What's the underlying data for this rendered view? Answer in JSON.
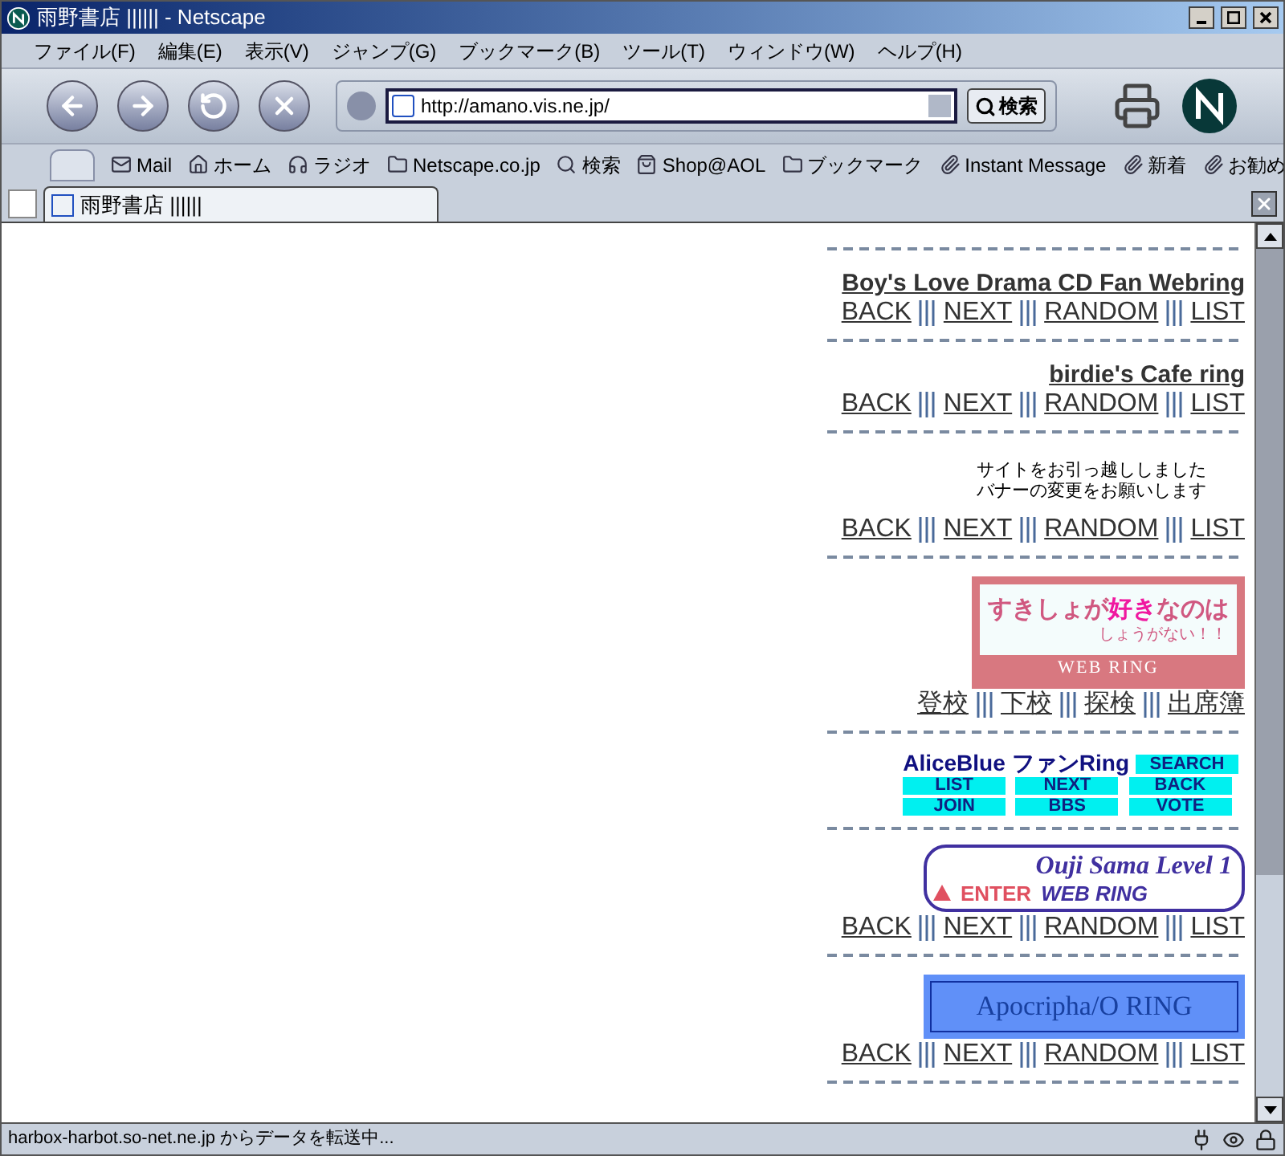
{
  "window": {
    "title": "雨野書店 ||||||  - Netscape"
  },
  "menu": [
    "ファイル(F)",
    "編集(E)",
    "表示(V)",
    "ジャンプ(G)",
    "ブックマーク(B)",
    "ツール(T)",
    "ウィンドウ(W)",
    "ヘルプ(H)"
  ],
  "address": {
    "value": "http://amano.vis.ne.jp/",
    "search_button": "検索"
  },
  "personal_bar": [
    {
      "kind": "mail",
      "label": "Mail"
    },
    {
      "kind": "home",
      "label": "ホーム"
    },
    {
      "kind": "radio",
      "label": "ラジオ"
    },
    {
      "kind": "my",
      "label": "Netscape.co.jp"
    },
    {
      "kind": "search",
      "label": "検索"
    },
    {
      "kind": "shop",
      "label": "Shop@AOL"
    },
    {
      "kind": "folder",
      "label": "ブックマーク"
    },
    {
      "kind": "link",
      "label": "Instant Message"
    },
    {
      "kind": "link",
      "label": "新着"
    },
    {
      "kind": "link",
      "label": "お勧め"
    }
  ],
  "tabs": [
    {
      "label": "雨野書店 ||||||",
      "selected": true
    }
  ],
  "blocks": [
    {
      "kind": "title",
      "title": "Boy's Love Drama CD Fan Webring",
      "links": [
        "BACK",
        "NEXT",
        "RANDOM",
        "LIST"
      ]
    },
    {
      "kind": "title",
      "title": "birdie's Cafe ring",
      "links": [
        "BACK",
        "NEXT",
        "RANDOM",
        "LIST"
      ]
    },
    {
      "kind": "notice",
      "lines": [
        "サイトをお引っ越ししました",
        "バナーの変更をお願いします"
      ],
      "links": [
        "BACK",
        "NEXT",
        "RANDOM",
        "LIST"
      ]
    },
    {
      "kind": "sukisho",
      "segments": [
        {
          "text": "すきしょが",
          "accent": false
        },
        {
          "text": "好き",
          "accent": true
        },
        {
          "text": "なのは",
          "accent": false
        }
      ],
      "sub": "しょうがない！！",
      "ring": "WEB RING",
      "links": [
        "登校",
        "下校",
        "探検",
        "出席簿"
      ]
    },
    {
      "kind": "grid",
      "heading": [
        "AliceBlue",
        "ファンRing"
      ],
      "buttons": [
        "SEARCH",
        "LIST",
        "NEXT",
        "BACK",
        "JOIN",
        "BBS",
        "VOTE"
      ]
    },
    {
      "kind": "ouji",
      "heading": "Ouji Sama  Level 1",
      "enter": "ENTER",
      "ring": "WEB RING",
      "links": [
        "BACK",
        "NEXT",
        "RANDOM",
        "LIST"
      ]
    },
    {
      "kind": "apocrypha",
      "heading": "Apocripha/O RING",
      "links": [
        "BACK",
        "NEXT",
        "RANDOM",
        "LIST"
      ]
    }
  ],
  "status_bar": {
    "text": "harbox-harbot.so-net.ne.jp からデータを転送中..."
  }
}
